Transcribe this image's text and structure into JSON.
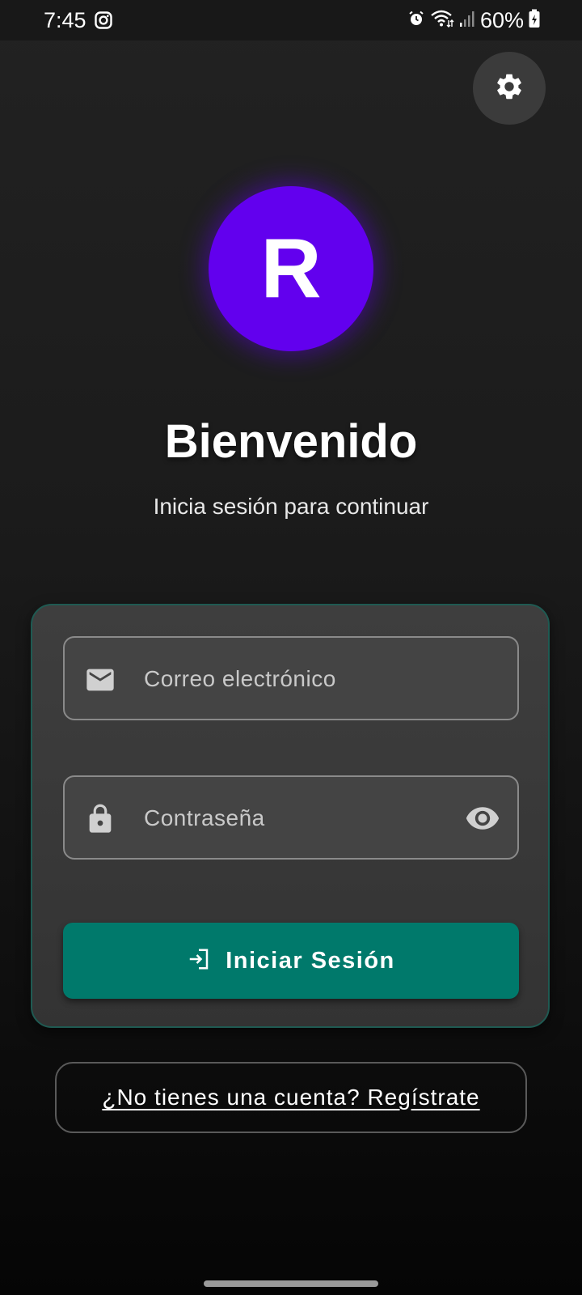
{
  "status_bar": {
    "time": "7:45",
    "battery": "60%",
    "icons": [
      "instagram-icon",
      "alarm-icon",
      "wifi-icon",
      "signal-icon",
      "battery-icon"
    ]
  },
  "header": {
    "settings_icon": "gear-icon"
  },
  "avatar": {
    "letter": "R",
    "color": "#6200ee"
  },
  "welcome": {
    "title": "Bienvenido",
    "subtitle": "Inicia sesión para continuar"
  },
  "form": {
    "email": {
      "placeholder": "Correo electrónico",
      "value": "",
      "icon": "mail-icon"
    },
    "password": {
      "placeholder": "Contraseña",
      "value": "",
      "icon": "lock-icon",
      "toggle_icon": "eye-icon"
    },
    "login_button": {
      "label": "Iniciar Sesión",
      "icon": "login-icon",
      "color": "#00796b"
    }
  },
  "register": {
    "label": "¿No tienes una cuenta? Regístrate"
  },
  "colors": {
    "accent_teal": "#00796b",
    "card_border": "#1f5a52",
    "background": "#1b1b1b"
  }
}
